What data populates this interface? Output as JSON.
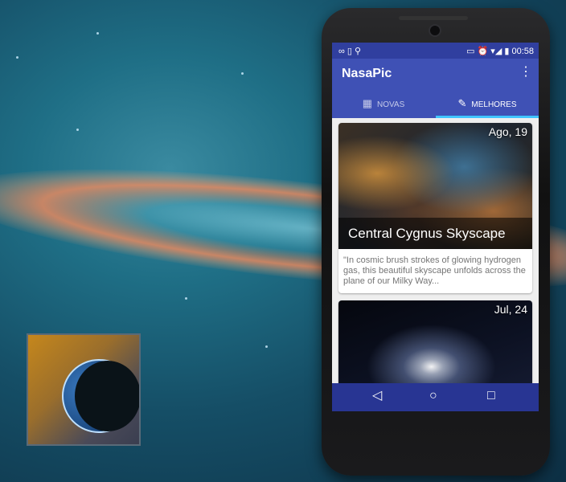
{
  "statusbar": {
    "left_icons": "∞ ▯ ⚲",
    "right_icons": "▭ ⏰ ▾◢ ▮",
    "time": "00:58"
  },
  "app": {
    "title": "NasaPic",
    "menu_icon": "more-vert-icon"
  },
  "tabs": [
    {
      "label": "NOVAS",
      "icon": "calendar-icon",
      "selected": false
    },
    {
      "label": "MELHORES",
      "icon": "pin-icon",
      "selected": true
    }
  ],
  "cards": [
    {
      "date": "Ago, 19",
      "title": "Central Cygnus Skyscape",
      "description": "\"In cosmic brush strokes of glowing hydrogen gas, this beautiful skyscape unfolds across the plane of our Milky Way..."
    },
    {
      "date": "Jul, 24",
      "title": "",
      "description": ""
    }
  ],
  "navbar": {
    "back": "◁",
    "home": "○",
    "recent": "□"
  },
  "colors": {
    "primary": "#3f51b5",
    "primary_dark": "#303f9f",
    "accent": "#40c4ff",
    "nav": "#283593"
  }
}
